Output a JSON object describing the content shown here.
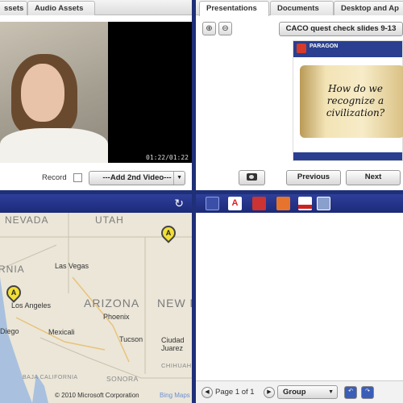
{
  "video_panel": {
    "tabs": [
      "ssets",
      "Audio Assets"
    ],
    "timestamp": "01:22/01:22",
    "record_label": "Record",
    "add_video_label": "---Add 2nd Video---",
    "dropdown_arrow": "▼"
  },
  "presentation_panel": {
    "tabs": [
      "Presentations",
      "Documents",
      "Desktop and Ap"
    ],
    "slide_title_button": "CACO quest check slides 9-13",
    "slide": {
      "brand": "PARAGON",
      "text": "How do we recognize a civilization?"
    },
    "previous_label": "Previous",
    "next_label": "Next",
    "icons": [
      "zoom-in-icon",
      "zoom-out-icon",
      "camera-icon"
    ]
  },
  "map_panel": {
    "state_labels": [
      "NEVADA",
      "UTAH",
      "ARIZONA",
      "NEW M",
      "RNIA",
      "SONORA",
      "BAJA CALIFORNIA",
      "CHIHUAHUA"
    ],
    "city_labels": [
      "Las Vegas",
      "Los Angeles",
      "Phoenix",
      "Tucson",
      "Diego",
      "Mexicali",
      "Ciudad Juarez"
    ],
    "pin_label": "A",
    "copyright": "© 2010 Microsoft Corporation",
    "bing_text": "Bing Maps",
    "refresh_icon": "refresh-icon"
  },
  "files_panel": {
    "toolbar_icons": [
      "blank-doc-icon",
      "adobe-icon",
      "film-icon",
      "slides-icon",
      "pdf-icon",
      "copy-icon"
    ],
    "page_label": "Page 1 of 1",
    "group_label": "Group",
    "dropdown_arrow": "▼"
  },
  "colors": {
    "frame_blue": "#1f2f78",
    "pin_yellow": "#f2df36"
  }
}
